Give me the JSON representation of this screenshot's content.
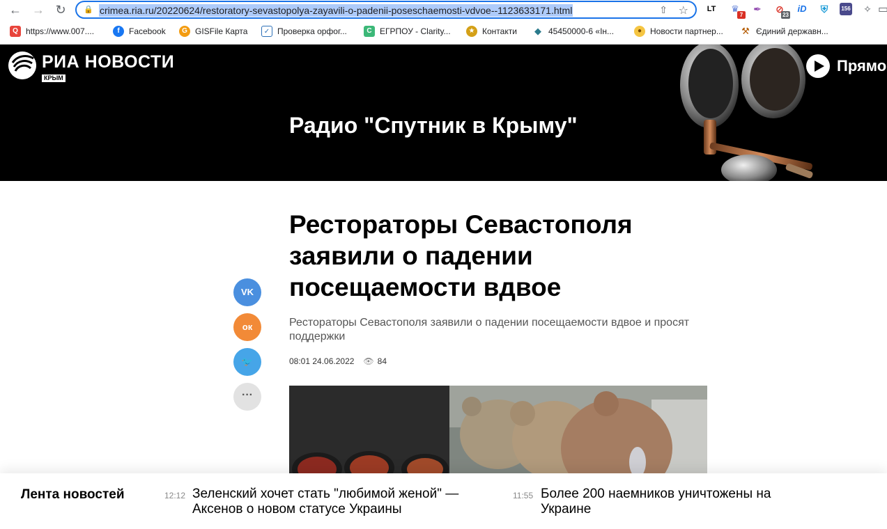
{
  "browser": {
    "url": "crimea.ria.ru/20220624/restoratory-sevastopolya-zayavili-o-padenii-poseschaemosti-vdvoe--1123633171.html",
    "extensions": [
      {
        "icon": "lt-icon",
        "text": "LT",
        "badge": ""
      },
      {
        "icon": "puzzle-person-icon",
        "text": "",
        "badge": "7"
      },
      {
        "icon": "feather-icon",
        "text": "",
        "badge": ""
      },
      {
        "icon": "blocker-icon",
        "text": "",
        "badge": "23"
      },
      {
        "icon": "id-icon",
        "text": "iD",
        "badge": ""
      },
      {
        "icon": "shield-icon",
        "text": "",
        "badge": ""
      },
      {
        "icon": "calendar-icon",
        "text": "156",
        "badge": ""
      },
      {
        "icon": "extensions-icon",
        "text": "",
        "badge": ""
      },
      {
        "icon": "window-icon",
        "text": "",
        "badge": ""
      }
    ],
    "bookmarks": [
      {
        "label": "https://www.007....",
        "icon": "search-icon"
      },
      {
        "label": "Facebook",
        "icon": "facebook-icon"
      },
      {
        "label": "GISFile Карта",
        "icon": "gisfile-icon"
      },
      {
        "label": "Проверка орфог...",
        "icon": "spellcheck-icon"
      },
      {
        "label": "ЕГРПОУ - Clarity...",
        "icon": "clarity-icon"
      },
      {
        "label": "Контакти",
        "icon": "contacts-icon"
      },
      {
        "label": "45450000-6 «Ін...",
        "icon": "diamond-icon"
      },
      {
        "label": "Новости партнер...",
        "icon": "partner-news-icon"
      },
      {
        "label": "Єдиний державн...",
        "icon": "gavel-icon"
      }
    ]
  },
  "header": {
    "logo_title": "РИА НОВОСТИ",
    "logo_region": "КРЫМ",
    "radio_title": "Радио \"Спутник в Крыму\"",
    "live_label": "Прямо"
  },
  "article": {
    "headline": "Рестораторы Севастополя заявили о падении посещаемости вдвое",
    "lead": "Рестораторы Севастополя заявили о падении посещаемости вдвое и просят поддержки",
    "datetime": "08:01 24.06.2022",
    "views": "84",
    "share": {
      "vk": "VK",
      "ok": "ок",
      "tw": "tw",
      "more": "···"
    }
  },
  "feed": {
    "title": "Лента новостей",
    "items": [
      {
        "time": "12:12",
        "text": "Зеленский хочет стать \"любимой женой\" — Аксенов о новом статусе Украины"
      },
      {
        "time": "11:55",
        "text": "Более 200 наемников уничтожены на Украине"
      }
    ]
  }
}
